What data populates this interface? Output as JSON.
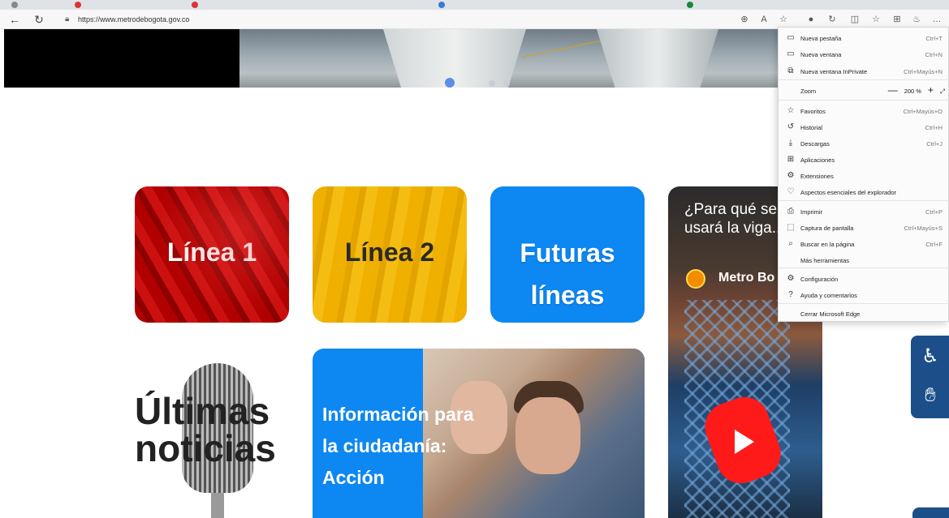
{
  "browser": {
    "url": "https://www.metrodebogota.gov.co",
    "back_icon": "←",
    "refresh_icon": "↻"
  },
  "page": {
    "cards": {
      "linea1": "Línea 1",
      "linea2": "Línea 2",
      "futuras_line1": "Futuras",
      "futuras_line2": "líneas"
    },
    "video": {
      "question": "¿Para qué se usará la viga...",
      "channel": "Metro Bo"
    },
    "news": {
      "line1": "Últimas",
      "line2": "noticias"
    },
    "info": {
      "text": "Información para la ciudadanía: Acción"
    }
  },
  "menu": {
    "items": [
      {
        "icon": "▭",
        "label": "Nueva pestaña",
        "shortcut": "Ctrl+T"
      },
      {
        "icon": "▭",
        "label": "Nueva ventana",
        "shortcut": "Ctrl+N"
      },
      {
        "icon": "⧉",
        "label": "Nueva ventana InPrivate",
        "shortcut": "Ctrl+Mayús+N"
      },
      {
        "label": "Zoom",
        "zoom_minus": "—",
        "zoom_value": "200 %",
        "zoom_plus": "+",
        "zoom_expand": "⤢"
      },
      {
        "icon": "☆",
        "label": "Favoritos",
        "shortcut": "Ctrl+Mayús+O"
      },
      {
        "icon": "↺",
        "label": "Historial",
        "shortcut": "Ctrl+H"
      },
      {
        "icon": "⤓",
        "label": "Descargas",
        "shortcut": "Ctrl+J"
      },
      {
        "icon": "⊞",
        "label": "Aplicaciones",
        "shortcut": ""
      },
      {
        "icon": "⚙",
        "label": "Extensiones",
        "shortcut": ""
      },
      {
        "icon": "♡",
        "label": "Aspectos esenciales del explorador",
        "shortcut": ""
      },
      {
        "icon": "⎙",
        "label": "Imprimir",
        "shortcut": "Ctrl+P"
      },
      {
        "icon": "⬚",
        "label": "Captura de pantalla",
        "shortcut": "Ctrl+Mayús+S"
      },
      {
        "icon": "⌕",
        "label": "Buscar en la página",
        "shortcut": "Ctrl+F"
      },
      {
        "icon": "",
        "label": "Más herramientas",
        "shortcut": ""
      },
      {
        "icon": "⚙",
        "label": "Configuración",
        "shortcut": ""
      },
      {
        "icon": "?",
        "label": "Ayuda y comentarios",
        "shortcut": ""
      },
      {
        "icon": "",
        "label": "Cerrar Microsoft Edge",
        "shortcut": ""
      }
    ]
  },
  "colors": {
    "futuras_blue": "#0d87f2",
    "linea1_red": "#b00000",
    "linea2_yellow": "#f0b000",
    "accessibility_blue": "#1c4f8a"
  }
}
